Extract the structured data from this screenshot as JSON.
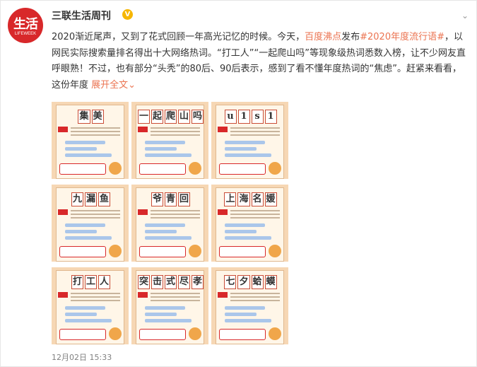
{
  "post": {
    "author": "三联生活周刊",
    "avatar": {
      "logo_text": "生活",
      "logo_sub": "LIFEWEEK"
    },
    "text_part1": "2020渐近尾声，又到了花式回顾一年高光记忆的时候。今天，",
    "mention": "百度沸点",
    "text_part2": "发布",
    "hashtag": "#2020年度流行语#",
    "text_part3": "，以网民实际搜索量排名得出十大网络热词。“打工人”“一起爬山吗”等现象级热词悉数入榜，让不少网友直呼眼熟！不过，也有部分“头秃”的80后、90后表示，感到了看不懂年度热词的“焦虑”。赶紧来看看，这份年度",
    "expand_label": "展开全文",
    "expand_icon": "chevron-down",
    "timestamp": "12月02日 15:33"
  },
  "grid": [
    {
      "chars": [
        "集",
        "美"
      ]
    },
    {
      "chars": [
        "一",
        "起",
        "爬",
        "山",
        "吗"
      ]
    },
    {
      "chars": [
        "u",
        "1",
        "s",
        "1"
      ]
    },
    {
      "chars": [
        "九",
        "漏",
        "鱼"
      ]
    },
    {
      "chars": [
        "爷",
        "青",
        "回"
      ]
    },
    {
      "chars": [
        "上",
        "海",
        "名",
        "媛"
      ]
    },
    {
      "chars": [
        "打",
        "工",
        "人"
      ]
    },
    {
      "chars": [
        "突",
        "击",
        "式",
        "尽",
        "孝"
      ]
    },
    {
      "chars": [
        "七",
        "夕",
        "蛤",
        "蟆"
      ]
    }
  ],
  "colors": {
    "link": "#eb7350",
    "brand_red": "#d8282a",
    "tile_bg": "#f6d7b4"
  }
}
